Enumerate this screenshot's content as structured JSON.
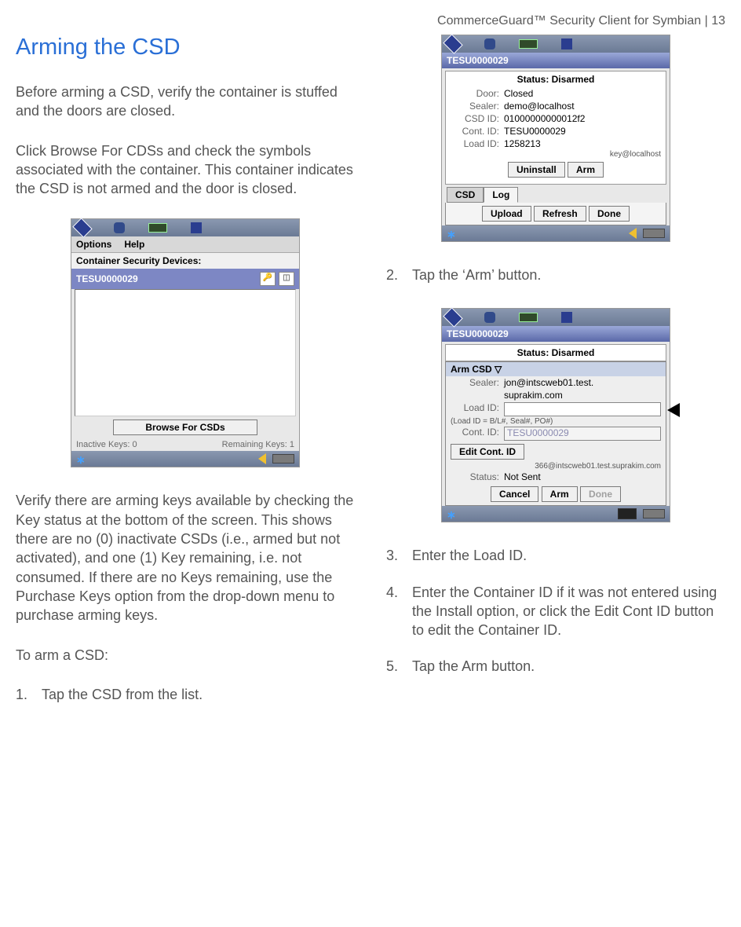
{
  "header": "CommerceGuard™ Security Client for Symbian  |  13",
  "section_title": "Arming the CSD",
  "left": {
    "p1": "Before arming a CSD, verify the container is stuffed and the doors are closed.",
    "p2": "Click Browse For CDSs and check the symbols associated with the container. This container indicates the CSD is not armed and the door is closed.",
    "p3": "Verify there are arming keys available by checking the Key status at the bottom of the screen. This shows there are no (0) inactivate CSDs (i.e., armed but not activated), and one (1) Key remaining, i.e. not consumed. If there are no Keys remaining, use the Purchase Keys option from the drop-down menu to purchase arming keys.",
    "p4": "To arm a CSD:",
    "step1": "Tap the CSD from the list."
  },
  "right": {
    "step2": "Tap the ‘Arm’ button.",
    "step3": "Enter the Load ID.",
    "step4": "Enter the Container ID if it was not entered using the Install  option, or click the Edit Cont ID button to edit the Container ID.",
    "step5": "Tap the Arm button."
  },
  "dev1": {
    "menu_options": "Options",
    "menu_help": "Help",
    "title": "Container Security Devices:",
    "row": "TESU0000029",
    "browse": "Browse For CSDs",
    "inactive": "Inactive Keys: 0",
    "remaining": "Remaining Keys:   1"
  },
  "dev2": {
    "title": "TESU0000029",
    "status": "Status: Disarmed",
    "door_k": "Door:",
    "door_v": "Closed",
    "sealer_k": "Sealer:",
    "sealer_v": "demo@localhost",
    "csd_k": "CSD ID:",
    "csd_v": "01000000000012f2",
    "cont_k": "Cont. ID:",
    "cont_v": "TESU0000029",
    "load_k": "Load ID:",
    "load_v": "1258213",
    "key": "key@localhost",
    "uninstall": "Uninstall",
    "arm": "Arm",
    "tab_csd": "CSD",
    "tab_log": "Log",
    "upload": "Upload",
    "refresh": "Refresh",
    "done": "Done"
  },
  "dev3": {
    "title": "TESU0000029",
    "status": "Status: Disarmed",
    "panel_title": "Arm CSD ▽",
    "sealer_k": "Sealer:",
    "sealer_v1": "jon@intscweb01.test.",
    "sealer_v2": "suprakim.com",
    "load_k": "Load ID:",
    "hint": "(Load ID = B/L#, Seal#, PO#)",
    "cont_k": "Cont. ID:",
    "cont_v": "TESU0000029",
    "edit": "Edit Cont. ID",
    "footer_email": "366@intscweb01.test.suprakim.com",
    "status_k": "Status:",
    "status_v": "Not Sent",
    "cancel": "Cancel",
    "arm": "Arm",
    "done": "Done"
  }
}
